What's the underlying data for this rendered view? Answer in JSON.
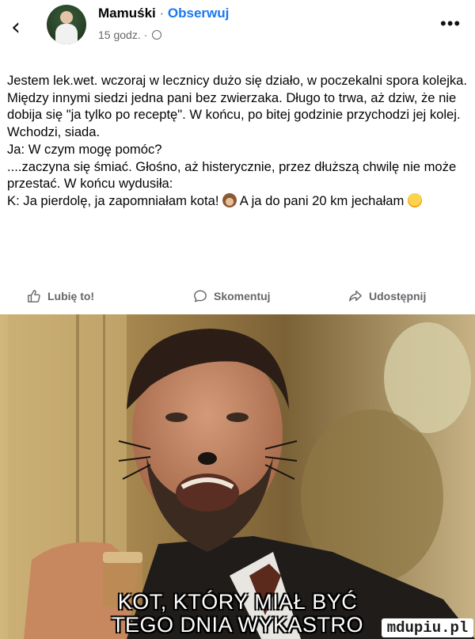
{
  "post": {
    "author": "Mamuśki",
    "separator": "·",
    "follow_label": "Obserwuj",
    "timestamp": "15 godz. ·",
    "privacy_icon": "globe-icon",
    "more_label": "•••",
    "text_part1": "Jestem lek.wet. wczoraj w lecznicy dużo się działo, w poczekalni spora kolejka. Między innymi siedzi jedna pani bez zwierzaka. Długo to trwa, aż dziw, że nie dobija się \"ja tylko po receptę\". W końcu, po bitej godzinie przychodzi jej kolej. Wchodzi, siada.\nJa: W czym mogę pomóc?\n....zaczyna się śmiać. Głośno, aż histerycznie, przez dłuższą chwilę nie może przestać. W końcu wydusiła:\nK: Ja pierdolę, ja zapomniałam kota! ",
    "emoji1": "see-no-evil-monkey-emoji",
    "text_part2": " A ja do pani 20 km jechałam ",
    "emoji2": "grinning-sweat-emoji"
  },
  "actions": {
    "like_label": "Lubię to!",
    "comment_label": "Skomentuj",
    "share_label": "Udostępnij"
  },
  "meme": {
    "caption_line1": "KOT, KTÓRY MIAŁ BYĆ",
    "caption_line2": "TEGO DNIA WYKASTRO",
    "watermark": "mdupiu.pl"
  },
  "colors": {
    "accent": "#1877f2",
    "secondary_text": "#65676b"
  }
}
